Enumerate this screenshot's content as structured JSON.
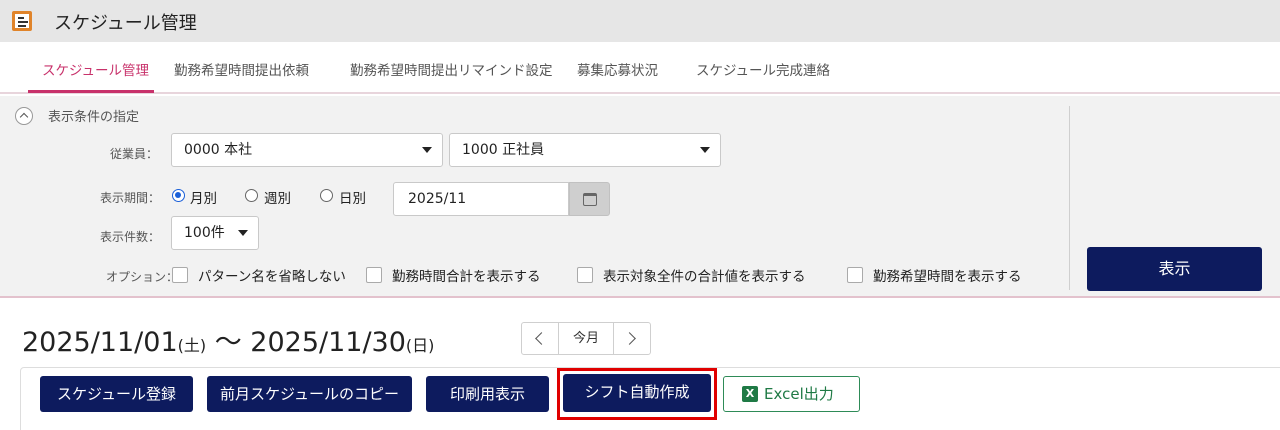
{
  "window": {
    "title": "スケジュール管理",
    "icon": "schedule-app-icon"
  },
  "tabs": [
    {
      "label": "スケジュール管理",
      "active": true
    },
    {
      "label": "勤務希望時間提出依頼",
      "active": false
    },
    {
      "label": "勤務希望時間提出リマインド設定",
      "active": false
    },
    {
      "label": "募集応募状況",
      "active": false
    },
    {
      "label": "スケジュール完成連絡",
      "active": false
    }
  ],
  "filter": {
    "title": "表示条件の指定",
    "employee_label": "従業員：",
    "company_select": "0000 本社",
    "employment_select": "1000 正社員",
    "period_label": "表示期間：",
    "period_options": [
      "月別",
      "週別",
      "日別"
    ],
    "period_selected": "月別",
    "date_value": "2025/11",
    "count_label": "表示件数：",
    "count_select": "100件",
    "options_label": "オプション：",
    "options": [
      "パターン名を省略しない",
      "勤務時間合計を表示する",
      "表示対象全件の合計値を表示する",
      "勤務希望時間を表示する"
    ],
    "show_button": "表示"
  },
  "period": {
    "start": "2025/11/01",
    "start_wd": "(土)",
    "sep": " 〜 ",
    "end": "2025/11/30",
    "end_wd": "(日)"
  },
  "pager": {
    "current": "今月"
  },
  "toolbar": {
    "register": "スケジュール登録",
    "copy_prev": "前月スケジュールのコピー",
    "print": "印刷用表示",
    "auto_shift": "シフト自動作成",
    "excel": "Excel出力"
  },
  "colors": {
    "accent": "#c8326b",
    "button": "#0d1b5e",
    "highlight": "#e00000",
    "excel": "#1f7a45"
  }
}
